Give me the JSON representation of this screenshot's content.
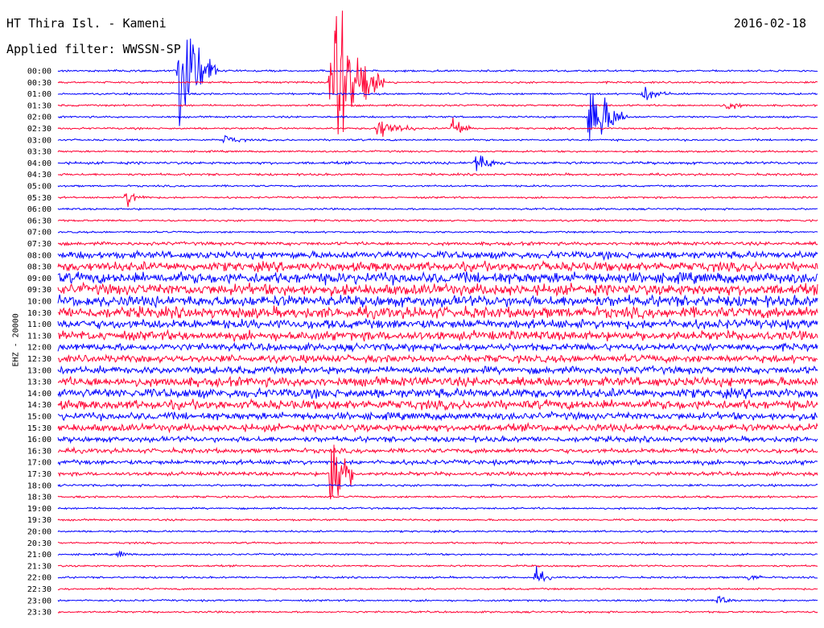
{
  "header": {
    "station": "HT Thira Isl. - Kameni",
    "date": "2016-02-18",
    "filter": "Applied filter: WWSSN-SP"
  },
  "chart_data": {
    "type": "line",
    "title": "HT Thira Isl. - Kameni",
    "ylabel": "EHZ - 20000",
    "row_times": [
      "00:00",
      "00:30",
      "01:00",
      "01:30",
      "02:00",
      "02:30",
      "03:00",
      "03:30",
      "04:00",
      "04:30",
      "05:00",
      "05:30",
      "06:00",
      "06:30",
      "07:00",
      "07:30",
      "08:00",
      "08:30",
      "09:00",
      "09:30",
      "10:00",
      "10:30",
      "11:00",
      "11:30",
      "12:00",
      "12:30",
      "13:00",
      "13:30",
      "14:00",
      "14:30",
      "15:00",
      "15:30",
      "16:00",
      "16:30",
      "17:00",
      "17:30",
      "18:00",
      "18:30",
      "19:00",
      "19:30",
      "20:00",
      "20:30",
      "21:00",
      "21:30",
      "22:00",
      "22:30",
      "23:00",
      "23:30"
    ],
    "row_colors": [
      "#0000ff",
      "#ff0033"
    ],
    "row_noise_level": [
      1,
      1,
      1,
      1,
      1,
      1,
      1,
      1,
      1.4,
      1.2,
      1,
      1,
      1,
      1,
      1,
      1.8,
      4,
      5,
      6,
      6,
      6,
      6,
      5,
      5,
      4,
      4,
      4,
      5,
      5,
      5,
      4,
      4,
      3,
      2.5,
      2.5,
      2,
      1.2,
      1.1,
      1,
      1,
      1,
      1,
      1,
      1,
      1,
      1,
      1,
      1
    ],
    "events": [
      {
        "time": "00:00",
        "x_fraction": 0.16,
        "amplitude": 120,
        "duration": 0.05
      },
      {
        "time": "00:30",
        "x_fraction": 0.36,
        "amplitude": 140,
        "duration": 0.07
      },
      {
        "time": "01:00",
        "x_fraction": 0.77,
        "amplitude": 12,
        "duration": 0.04
      },
      {
        "time": "01:30",
        "x_fraction": 0.88,
        "amplitude": 8,
        "duration": 0.03
      },
      {
        "time": "02:00",
        "x_fraction": 0.7,
        "amplitude": 70,
        "duration": 0.05
      },
      {
        "time": "02:30",
        "x_fraction": 0.52,
        "amplitude": 20,
        "duration": 0.03
      },
      {
        "time": "02:30",
        "x_fraction": 0.42,
        "amplitude": 18,
        "duration": 0.05
      },
      {
        "time": "03:00",
        "x_fraction": 0.22,
        "amplitude": 8,
        "duration": 0.03
      },
      {
        "time": "04:00",
        "x_fraction": 0.55,
        "amplitude": 16,
        "duration": 0.04
      },
      {
        "time": "05:30",
        "x_fraction": 0.09,
        "amplitude": 14,
        "duration": 0.03
      },
      {
        "time": "17:30",
        "x_fraction": 0.36,
        "amplitude": 110,
        "duration": 0.03
      },
      {
        "time": "21:00",
        "x_fraction": 0.08,
        "amplitude": 6,
        "duration": 0.02
      },
      {
        "time": "22:00",
        "x_fraction": 0.63,
        "amplitude": 14,
        "duration": 0.02
      },
      {
        "time": "22:00",
        "x_fraction": 0.91,
        "amplitude": 8,
        "duration": 0.02
      },
      {
        "time": "23:00",
        "x_fraction": 0.87,
        "amplitude": 8,
        "duration": 0.02
      }
    ]
  }
}
